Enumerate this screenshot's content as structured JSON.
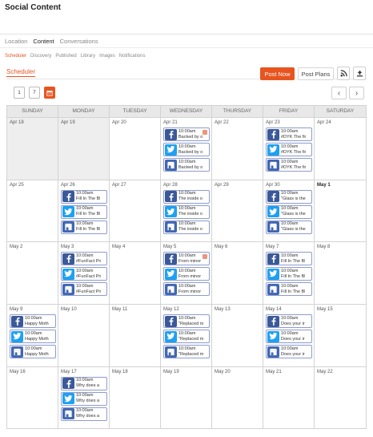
{
  "page": {
    "title": "Social Content"
  },
  "main_tabs": [
    "Location",
    "Content",
    "Conversations"
  ],
  "sub_tabs": [
    "Scheduler",
    "Discovery",
    "Published",
    "Library",
    "Images",
    "Notifications"
  ],
  "section_label": "Scheduler",
  "toolbar": {
    "post_now": "Post Now",
    "post_plans": "Post Plans",
    "rss_icon": "rss-icon",
    "export_icon": "upload-icon"
  },
  "view_buttons": [
    {
      "icon": "day-view-icon",
      "label": "1"
    },
    {
      "icon": "week-view-icon",
      "label": "7"
    },
    {
      "icon": "month-view-icon",
      "label": ""
    }
  ],
  "nav": {
    "prev": "‹",
    "next": "›"
  },
  "days": [
    "SUNDAY",
    "MONDAY",
    "TUESDAY",
    "WEDNESDAY",
    "THURSDAY",
    "FRIDAY",
    "SATURDAY"
  ],
  "weeks": [
    [
      {
        "date": "Apr 18",
        "past": true,
        "posts": []
      },
      {
        "date": "Apr 19",
        "past": true,
        "posts": []
      },
      {
        "date": "Apr 20",
        "posts": []
      },
      {
        "date": "Apr 21",
        "posts": [
          {
            "network": "facebook",
            "time": "10:00am",
            "text": "Backed by o",
            "warning": true
          },
          {
            "network": "twitter",
            "time": "10:00am",
            "text": "Backed by o"
          },
          {
            "network": "google",
            "time": "10:00am",
            "text": "Backed by o"
          }
        ]
      },
      {
        "date": "Apr 22",
        "posts": []
      },
      {
        "date": "Apr 23",
        "posts": [
          {
            "network": "facebook",
            "time": "10:00am",
            "text": "#DYK The fir"
          },
          {
            "network": "twitter",
            "time": "10:00am",
            "text": "#DYK The fir"
          },
          {
            "network": "google",
            "time": "10:00am",
            "text": "#DYK The fir"
          }
        ]
      },
      {
        "date": "Apr 24",
        "posts": []
      }
    ],
    [
      {
        "date": "Apr 25",
        "posts": []
      },
      {
        "date": "Apr 26",
        "posts": [
          {
            "network": "facebook",
            "time": "10:00am",
            "text": "Fill In The Bl"
          },
          {
            "network": "twitter",
            "time": "10:00am",
            "text": "Fill In The Bl"
          },
          {
            "network": "google",
            "time": "10:00am",
            "text": "Fill In The Bl"
          }
        ]
      },
      {
        "date": "Apr 27",
        "posts": []
      },
      {
        "date": "Apr 28",
        "posts": [
          {
            "network": "facebook",
            "time": "10:00am",
            "text": "The inside o"
          },
          {
            "network": "twitter",
            "time": "10:00am",
            "text": "The inside o"
          },
          {
            "network": "google",
            "time": "10:00am",
            "text": "The inside o"
          }
        ]
      },
      {
        "date": "Apr 29",
        "posts": []
      },
      {
        "date": "Apr 30",
        "posts": [
          {
            "network": "facebook",
            "time": "10:00am",
            "text": "\"Glass is the"
          },
          {
            "network": "twitter",
            "time": "10:00am",
            "text": "\"Glass is the"
          },
          {
            "network": "google",
            "time": "10:00am",
            "text": "\"Glass is the"
          }
        ]
      },
      {
        "date": "May 1",
        "bold": true,
        "posts": []
      }
    ],
    [
      {
        "date": "May 2",
        "posts": []
      },
      {
        "date": "May 3",
        "posts": [
          {
            "network": "facebook",
            "time": "10:00am",
            "text": "#FunFact Pri"
          },
          {
            "network": "twitter",
            "time": "10:00am",
            "text": "#FunFact Pri"
          },
          {
            "network": "google",
            "time": "10:00am",
            "text": "#FunFact Pri"
          }
        ]
      },
      {
        "date": "May 4",
        "posts": []
      },
      {
        "date": "May 5",
        "posts": [
          {
            "network": "facebook",
            "time": "10:00am",
            "text": "From minor",
            "warning": true
          },
          {
            "network": "twitter",
            "time": "10:00am",
            "text": "From minor"
          },
          {
            "network": "google",
            "time": "10:00am",
            "text": "From minor"
          }
        ]
      },
      {
        "date": "May 6",
        "posts": []
      },
      {
        "date": "May 7",
        "posts": [
          {
            "network": "facebook",
            "time": "10:00am",
            "text": "Fill In The Bl"
          },
          {
            "network": "twitter",
            "time": "10:00am",
            "text": "Fill In The Bl"
          },
          {
            "network": "google",
            "time": "10:00am",
            "text": "Fill In The Bl"
          }
        ]
      },
      {
        "date": "May 8",
        "posts": []
      }
    ],
    [
      {
        "date": "May 9",
        "posts": [
          {
            "network": "facebook",
            "time": "10:00am",
            "text": "Happy Moth"
          },
          {
            "network": "twitter",
            "time": "10:00am",
            "text": "Happy Moth"
          },
          {
            "network": "google",
            "time": "10:00am",
            "text": "Happy Moth"
          }
        ]
      },
      {
        "date": "May 10",
        "posts": []
      },
      {
        "date": "May 11",
        "posts": []
      },
      {
        "date": "May 12",
        "posts": [
          {
            "network": "facebook",
            "time": "10:00am",
            "text": "\"Replaced m"
          },
          {
            "network": "twitter",
            "time": "10:00am",
            "text": "\"Replaced m"
          },
          {
            "network": "google",
            "time": "10:00am",
            "text": "\"Replaced m"
          }
        ]
      },
      {
        "date": "May 13",
        "posts": []
      },
      {
        "date": "May 14",
        "posts": [
          {
            "network": "facebook",
            "time": "10:00am",
            "text": "Does your ir"
          },
          {
            "network": "twitter",
            "time": "10:00am",
            "text": "Does your ir"
          },
          {
            "network": "google",
            "time": "10:00am",
            "text": "Does your ir"
          }
        ]
      },
      {
        "date": "May 15",
        "posts": []
      }
    ],
    [
      {
        "date": "May 16",
        "posts": []
      },
      {
        "date": "May 17",
        "posts": [
          {
            "network": "facebook",
            "time": "10:00am",
            "text": "Why does a"
          },
          {
            "network": "twitter",
            "time": "10:00am",
            "text": "Why does a"
          },
          {
            "network": "google",
            "time": "10:00am",
            "text": "Why does a"
          }
        ]
      },
      {
        "date": "May 18",
        "posts": []
      },
      {
        "date": "May 19",
        "posts": []
      },
      {
        "date": "May 20",
        "posts": []
      },
      {
        "date": "May 21",
        "posts": []
      },
      {
        "date": "May 22",
        "posts": []
      }
    ]
  ],
  "colors": {
    "accent": "#e8541f",
    "facebook": "#3b5998",
    "twitter": "#1da1f2",
    "google": "#4267b2",
    "warning": "#e9967a"
  }
}
